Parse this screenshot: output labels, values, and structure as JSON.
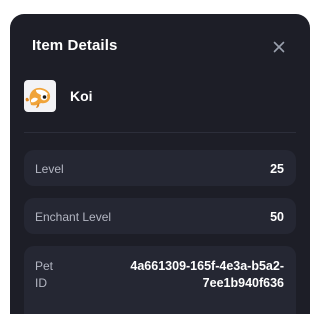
{
  "dialog": {
    "title": "Item Details",
    "close_icon": "close-icon"
  },
  "pet": {
    "name": "Koi",
    "icon": "koi-pet-icon"
  },
  "details": {
    "level_label": "Level",
    "level_value": "25",
    "enchant_label": "Enchant Level",
    "enchant_value": "50",
    "petid_label_line1": "Pet",
    "petid_label_line2": "ID",
    "petid_value_line1": "4a661309-165f-4e3a-b5a2-",
    "petid_value_line2": "7ee1b940f636"
  },
  "colors": {
    "panel_bg": "#1d1e27",
    "row_bg": "#252733",
    "label_text": "#b3b6c2",
    "value_text": "#ffffff"
  }
}
